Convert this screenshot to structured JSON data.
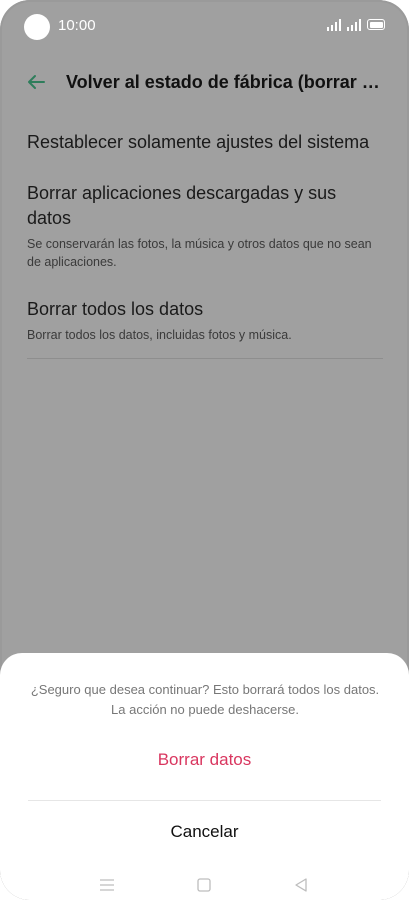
{
  "status": {
    "time": "10:00"
  },
  "header": {
    "title": "Volver al estado de fábrica (borrar to..."
  },
  "options": [
    {
      "title": "Restablecer solamente ajustes del sistema",
      "subtitle": ""
    },
    {
      "title": "Borrar aplicaciones descargadas y sus datos",
      "subtitle": "Se conservarán las fotos, la música y otros datos que no sean de aplicaciones."
    },
    {
      "title": "Borrar todos los datos",
      "subtitle": "Borrar todos los datos, incluidas fotos y música."
    }
  ],
  "dialog": {
    "message": "¿Seguro que desea continuar? Esto borrará todos los datos. La acción no puede deshacerse.",
    "confirm_label": "Borrar datos",
    "cancel_label": "Cancelar"
  },
  "colors": {
    "accent": "#2e9e6b",
    "danger": "#d9365f",
    "scrim": "#a0a0a0"
  },
  "icons": {
    "back": "arrow-left-icon",
    "nav_menu": "menu-icon",
    "nav_home": "square-icon",
    "nav_back": "triangle-back-icon"
  }
}
